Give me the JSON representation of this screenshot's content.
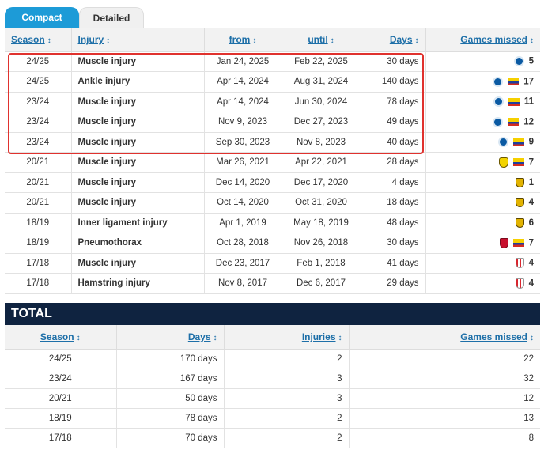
{
  "tabs": {
    "compact": "Compact",
    "detailed": "Detailed"
  },
  "injuries": {
    "headers": {
      "season": "Season",
      "injury": "Injury",
      "from": "from",
      "until": "until",
      "days": "Days",
      "games_missed": "Games missed"
    },
    "sort_glyph": "↕",
    "rows": [
      {
        "season": "24/25",
        "injury": "Muscle injury",
        "from": "Jan 24, 2025",
        "until": "Feb 22, 2025",
        "days": "30 days",
        "crests": [
          "brighton"
        ],
        "games": "5"
      },
      {
        "season": "24/25",
        "injury": "Ankle injury",
        "from": "Apr 14, 2024",
        "until": "Aug 31, 2024",
        "days": "140 days",
        "crests": [
          "brighton",
          "ecuador"
        ],
        "games": "17"
      },
      {
        "season": "23/24",
        "injury": "Muscle injury",
        "from": "Apr 14, 2024",
        "until": "Jun 30, 2024",
        "days": "78 days",
        "crests": [
          "brighton",
          "ecuador"
        ],
        "games": "11"
      },
      {
        "season": "23/24",
        "injury": "Muscle injury",
        "from": "Nov 9, 2023",
        "until": "Dec 27, 2023",
        "days": "49 days",
        "crests": [
          "brighton",
          "ecuador"
        ],
        "games": "12"
      },
      {
        "season": "23/24",
        "injury": "Muscle injury",
        "from": "Sep 30, 2023",
        "until": "Nov 8, 2023",
        "days": "40 days",
        "crests": [
          "brighton",
          "ecuador"
        ],
        "games": "9"
      },
      {
        "season": "20/21",
        "injury": "Muscle injury",
        "from": "Mar 26, 2021",
        "until": "Apr 22, 2021",
        "days": "28 days",
        "crests": [
          "villarreal",
          "ecuador"
        ],
        "games": "7"
      },
      {
        "season": "20/21",
        "injury": "Muscle injury",
        "from": "Dec 14, 2020",
        "until": "Dec 17, 2020",
        "days": "4 days",
        "crests": [
          "villa2"
        ],
        "games": "1"
      },
      {
        "season": "20/21",
        "injury": "Muscle injury",
        "from": "Oct 14, 2020",
        "until": "Oct 31, 2020",
        "days": "18 days",
        "crests": [
          "villa2"
        ],
        "games": "4"
      },
      {
        "season": "18/19",
        "injury": "Inner ligament injury",
        "from": "Apr 1, 2019",
        "until": "May 18, 2019",
        "days": "48 days",
        "crests": [
          "villa2"
        ],
        "games": "6"
      },
      {
        "season": "18/19",
        "injury": "Pneumothorax",
        "from": "Oct 28, 2018",
        "until": "Nov 26, 2018",
        "days": "30 days",
        "crests": [
          "mallorca",
          "ecuador"
        ],
        "games": "7"
      },
      {
        "season": "17/18",
        "injury": "Muscle injury",
        "from": "Dec 23, 2017",
        "until": "Feb 1, 2018",
        "days": "41 days",
        "crests": [
          "almeria"
        ],
        "games": "4"
      },
      {
        "season": "17/18",
        "injury": "Hamstring injury",
        "from": "Nov 8, 2017",
        "until": "Dec 6, 2017",
        "days": "29 days",
        "crests": [
          "almeria"
        ],
        "games": "4"
      }
    ]
  },
  "total": {
    "title": "TOTAL",
    "headers": {
      "season": "Season",
      "days": "Days",
      "injuries": "Injuries",
      "games_missed": "Games missed"
    },
    "rows": [
      {
        "season": "24/25",
        "days": "170 days",
        "injuries": "2",
        "games": "22"
      },
      {
        "season": "23/24",
        "days": "167 days",
        "injuries": "3",
        "games": "32"
      },
      {
        "season": "20/21",
        "days": "50 days",
        "injuries": "3",
        "games": "12"
      },
      {
        "season": "18/19",
        "days": "78 days",
        "injuries": "2",
        "games": "13"
      },
      {
        "season": "17/18",
        "days": "70 days",
        "injuries": "2",
        "games": "8"
      }
    ]
  },
  "colors": {
    "accent": "#1d9bd7",
    "header_link": "#1d6fa8",
    "total_bar": "#0f2340",
    "highlight": "#e0322e"
  }
}
